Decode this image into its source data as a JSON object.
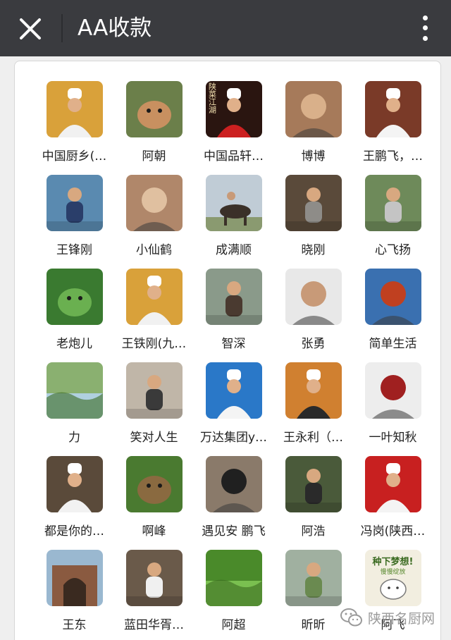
{
  "header": {
    "title": "AA收款",
    "close_icon": "close-icon",
    "more_icon": "more-vertical-icon"
  },
  "members": [
    {
      "name": "中国厨乡(…",
      "colors": [
        "#d9a13a",
        "#f1f1f1"
      ],
      "motif": "chef"
    },
    {
      "name": "阿朝",
      "colors": [
        "#6b7f4a",
        "#c89060"
      ],
      "motif": "animal"
    },
    {
      "name": "中国品轩…",
      "colors": [
        "#2a1510",
        "#cc2020"
      ],
      "motif": "chef"
    },
    {
      "name": "博博",
      "colors": [
        "#a67a5a",
        "#d9b08a"
      ],
      "motif": "face"
    },
    {
      "name": "王鹏飞，…",
      "colors": [
        "#7a3a28",
        "#f4f4f4"
      ],
      "motif": "chef"
    },
    {
      "name": "王锋刚",
      "colors": [
        "#5a8ab0",
        "#2a3e6a"
      ],
      "motif": "person"
    },
    {
      "name": "小仙鹤",
      "colors": [
        "#b0876a",
        "#e0c0a0"
      ],
      "motif": "face"
    },
    {
      "name": "成满顺",
      "colors": [
        "#c0ccd6",
        "#3a3028"
      ],
      "motif": "horse"
    },
    {
      "name": "晓刚",
      "colors": [
        "#5a4a3a",
        "#8e8c88"
      ],
      "motif": "person"
    },
    {
      "name": "心飞扬",
      "colors": [
        "#6e8a5a",
        "#c4c4c4"
      ],
      "motif": "person"
    },
    {
      "name": "老炮儿",
      "colors": [
        "#3a7a30",
        "#6ab050"
      ],
      "motif": "animal"
    },
    {
      "name": "王铁刚(九…",
      "colors": [
        "#d9a13a",
        "#f1f1f1"
      ],
      "motif": "chef"
    },
    {
      "name": "智深",
      "colors": [
        "#8a9a8a",
        "#4a3a30"
      ],
      "motif": "person"
    },
    {
      "name": "张勇",
      "colors": [
        "#e8e8e8",
        "#c89a78"
      ],
      "motif": "face"
    },
    {
      "name": "简单生活",
      "colors": [
        "#3a70b0",
        "#c04020"
      ],
      "motif": "face"
    },
    {
      "name": "力",
      "colors": [
        "#8ab070",
        "#b0d0e0"
      ],
      "motif": "scenery"
    },
    {
      "name": "笑对人生",
      "colors": [
        "#c0b6a8",
        "#3a3a3a"
      ],
      "motif": "person"
    },
    {
      "name": "万达集团y…",
      "colors": [
        "#2a78c8",
        "#f4f4f4"
      ],
      "motif": "chef"
    },
    {
      "name": "王永利（…",
      "colors": [
        "#d08030",
        "#2a2a2a"
      ],
      "motif": "chef"
    },
    {
      "name": "一叶知秋",
      "colors": [
        "#ededed",
        "#a02020"
      ],
      "motif": "face"
    },
    {
      "name": "都是你的…",
      "colors": [
        "#5a4a3a",
        "#f2f2f2"
      ],
      "motif": "chef"
    },
    {
      "name": "啊峰",
      "colors": [
        "#4a7a30",
        "#8a6a40"
      ],
      "motif": "animal"
    },
    {
      "name": "遇见安 鹏飞",
      "colors": [
        "#8a7a6a",
        "#202020"
      ],
      "motif": "face"
    },
    {
      "name": "阿浩",
      "colors": [
        "#4a5a3a",
        "#2a2a2a"
      ],
      "motif": "person"
    },
    {
      "name": "冯岗(陕西…",
      "colors": [
        "#c82020",
        "#f4f4f4"
      ],
      "motif": "chef"
    },
    {
      "name": "王东",
      "colors": [
        "#9ab8d0",
        "#8a5a40"
      ],
      "motif": "arch"
    },
    {
      "name": "蓝田华胥…",
      "colors": [
        "#6a5a4a",
        "#f0f0f0"
      ],
      "motif": "person"
    },
    {
      "name": "阿超",
      "colors": [
        "#4a8a2a",
        "#7ac050"
      ],
      "motif": "scenery"
    },
    {
      "name": "昕昕",
      "colors": [
        "#a0b0a0",
        "#6a8a50"
      ],
      "motif": "person"
    },
    {
      "name": "阿飞",
      "colors": [
        "#f2eee0",
        "#5a7a30"
      ],
      "motif": "rabbit"
    }
  ],
  "avatar_texts": {
    "m3": "陕菜江湖",
    "m30_line1": "种下梦想!",
    "m30_line2": "慢慢绽放"
  },
  "watermark": {
    "text": "陕西名厨网",
    "icon": "wechat-icon"
  }
}
